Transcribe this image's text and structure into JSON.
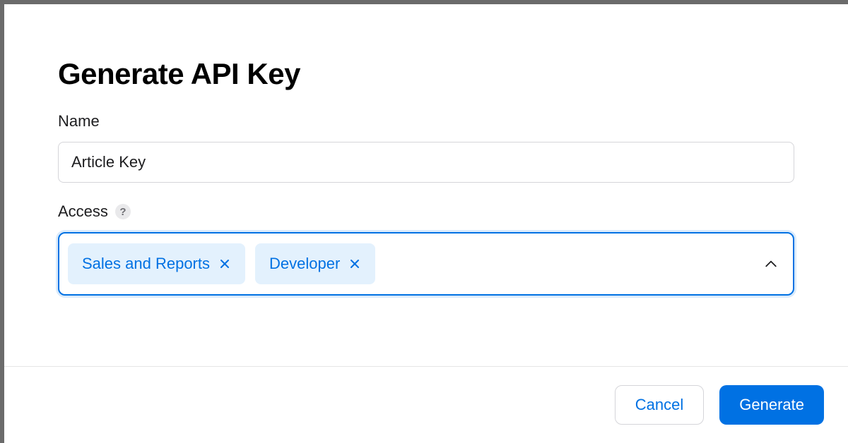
{
  "modal": {
    "title": "Generate API Key",
    "name_field": {
      "label": "Name",
      "value": "Article Key"
    },
    "access_field": {
      "label": "Access",
      "help_symbol": "?",
      "tags": [
        {
          "label": "Sales and Reports"
        },
        {
          "label": "Developer"
        }
      ]
    },
    "footer": {
      "cancel_label": "Cancel",
      "generate_label": "Generate"
    }
  }
}
